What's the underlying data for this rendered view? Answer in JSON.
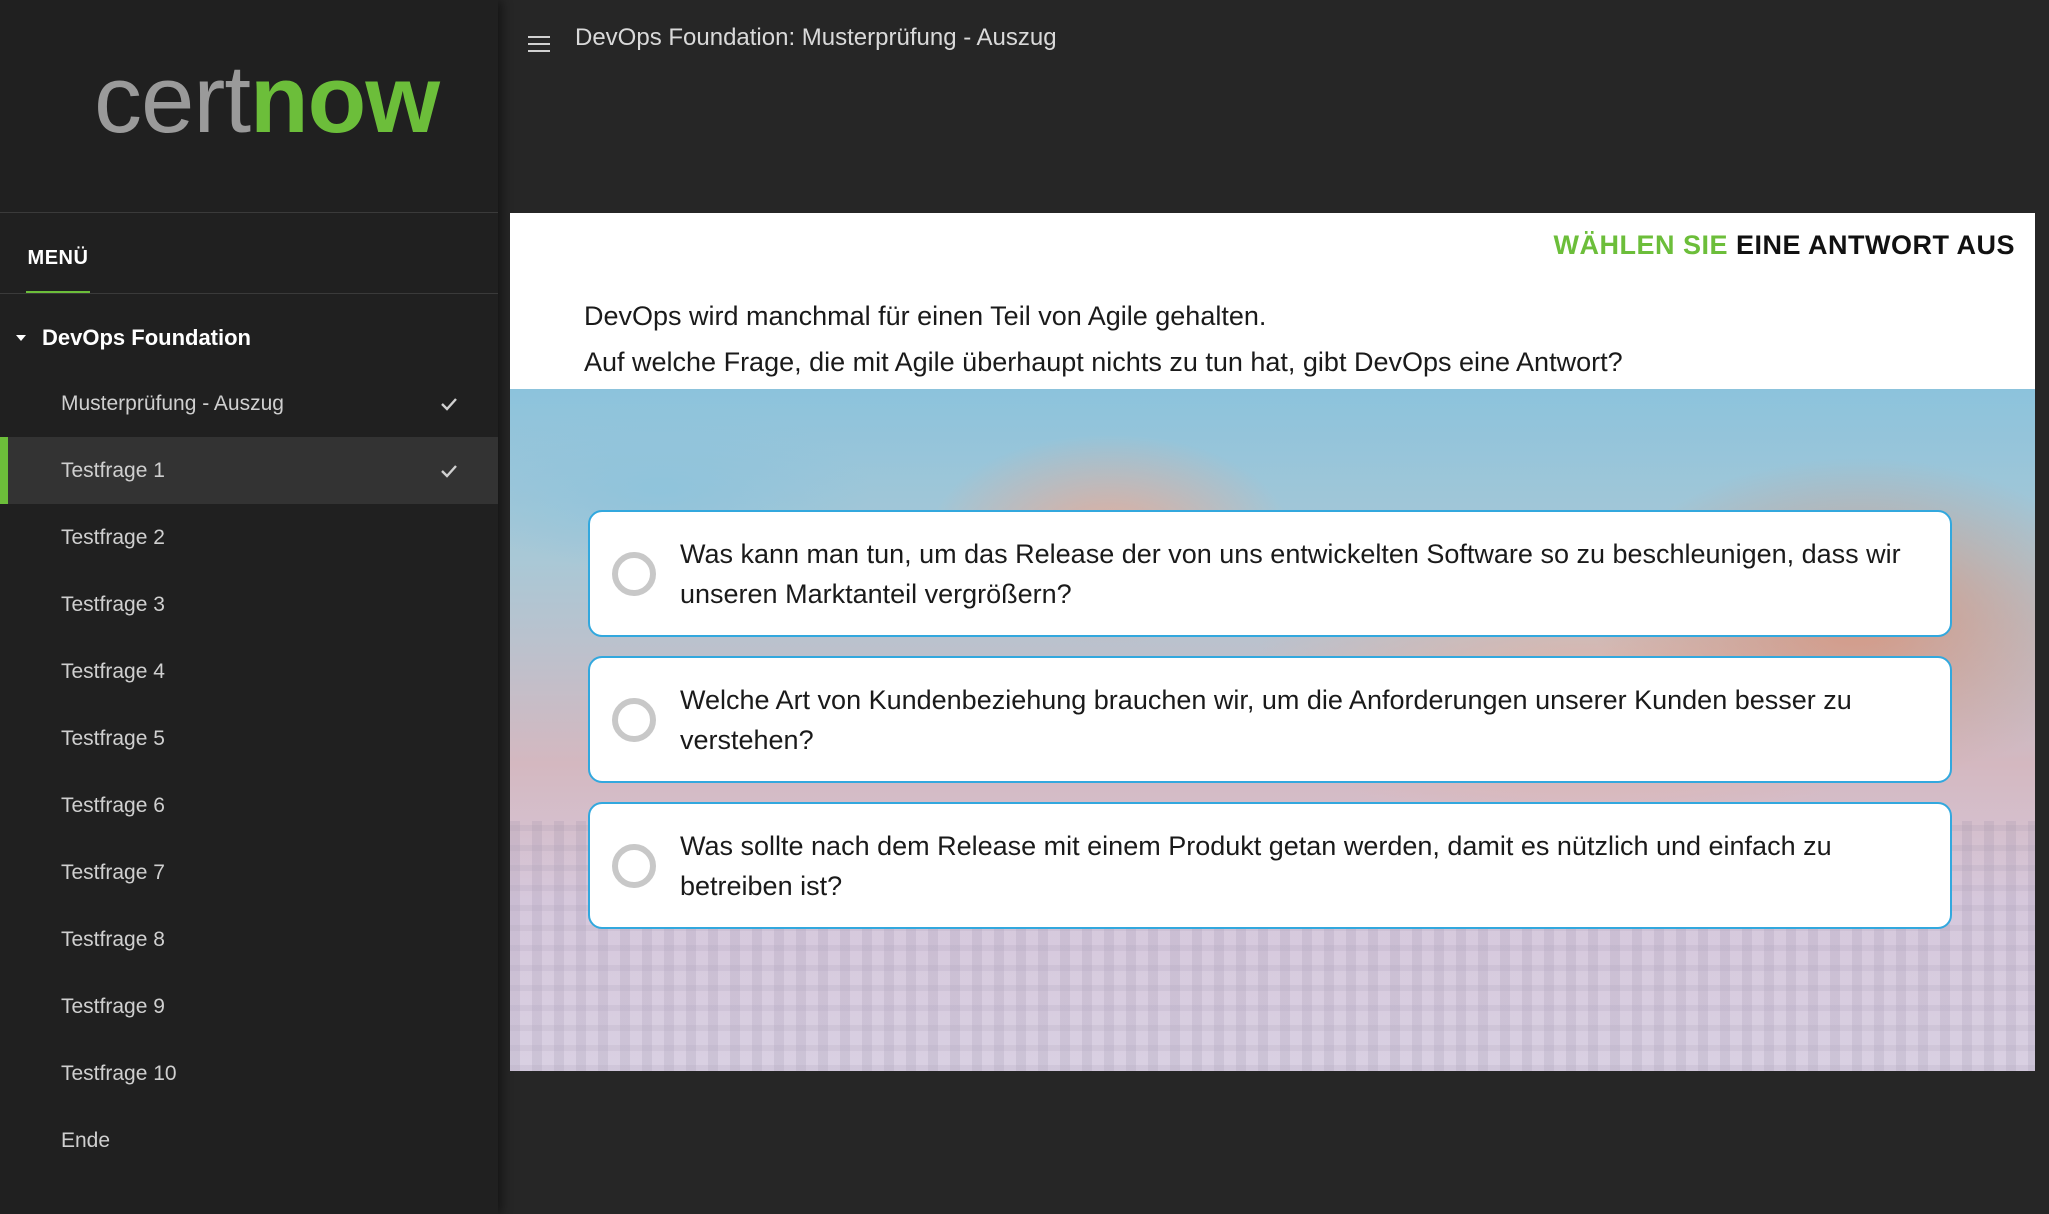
{
  "logo": {
    "part1": "cert",
    "part2": "now"
  },
  "sidebar": {
    "menu_label": "MENÜ",
    "section_title": "DevOps Foundation",
    "items": [
      {
        "label": "Musterprüfung - Auszug",
        "checked": true,
        "active": false
      },
      {
        "label": "Testfrage 1",
        "checked": true,
        "active": true
      },
      {
        "label": "Testfrage 2",
        "checked": false,
        "active": false
      },
      {
        "label": "Testfrage 3",
        "checked": false,
        "active": false
      },
      {
        "label": "Testfrage 4",
        "checked": false,
        "active": false
      },
      {
        "label": "Testfrage 5",
        "checked": false,
        "active": false
      },
      {
        "label": "Testfrage 6",
        "checked": false,
        "active": false
      },
      {
        "label": "Testfrage 7",
        "checked": false,
        "active": false
      },
      {
        "label": "Testfrage 8",
        "checked": false,
        "active": false
      },
      {
        "label": "Testfrage 9",
        "checked": false,
        "active": false
      },
      {
        "label": "Testfrage 10",
        "checked": false,
        "active": false
      },
      {
        "label": "Ende",
        "checked": false,
        "active": false
      }
    ]
  },
  "header": {
    "title": "DevOps Foundation: Musterprüfung - Auszug"
  },
  "question": {
    "instruction_green": "WÄHLEN SIE",
    "instruction_black": "EINE ANTWORT AUS",
    "line1": "DevOps wird manchmal für einen Teil von Agile gehalten.",
    "line2": "Auf welche Frage, die mit Agile überhaupt nichts zu tun hat, gibt DevOps eine Antwort?",
    "answers": [
      "Was kann man tun, um das Release der von uns entwickelten Software so zu beschleunigen, dass wir unseren Marktanteil vergrößern?",
      "Welche Art von Kundenbeziehung brauchen wir, um die Anforderungen unserer Kunden besser zu verstehen?",
      "Was sollte nach dem Release mit einem Produkt getan werden, damit es nützlich und einfach zu betreiben ist?"
    ]
  },
  "colors": {
    "accent_green": "#6cbe3a",
    "answer_border": "#32a8de",
    "sidebar_bg": "#202020",
    "page_bg": "#262626"
  }
}
